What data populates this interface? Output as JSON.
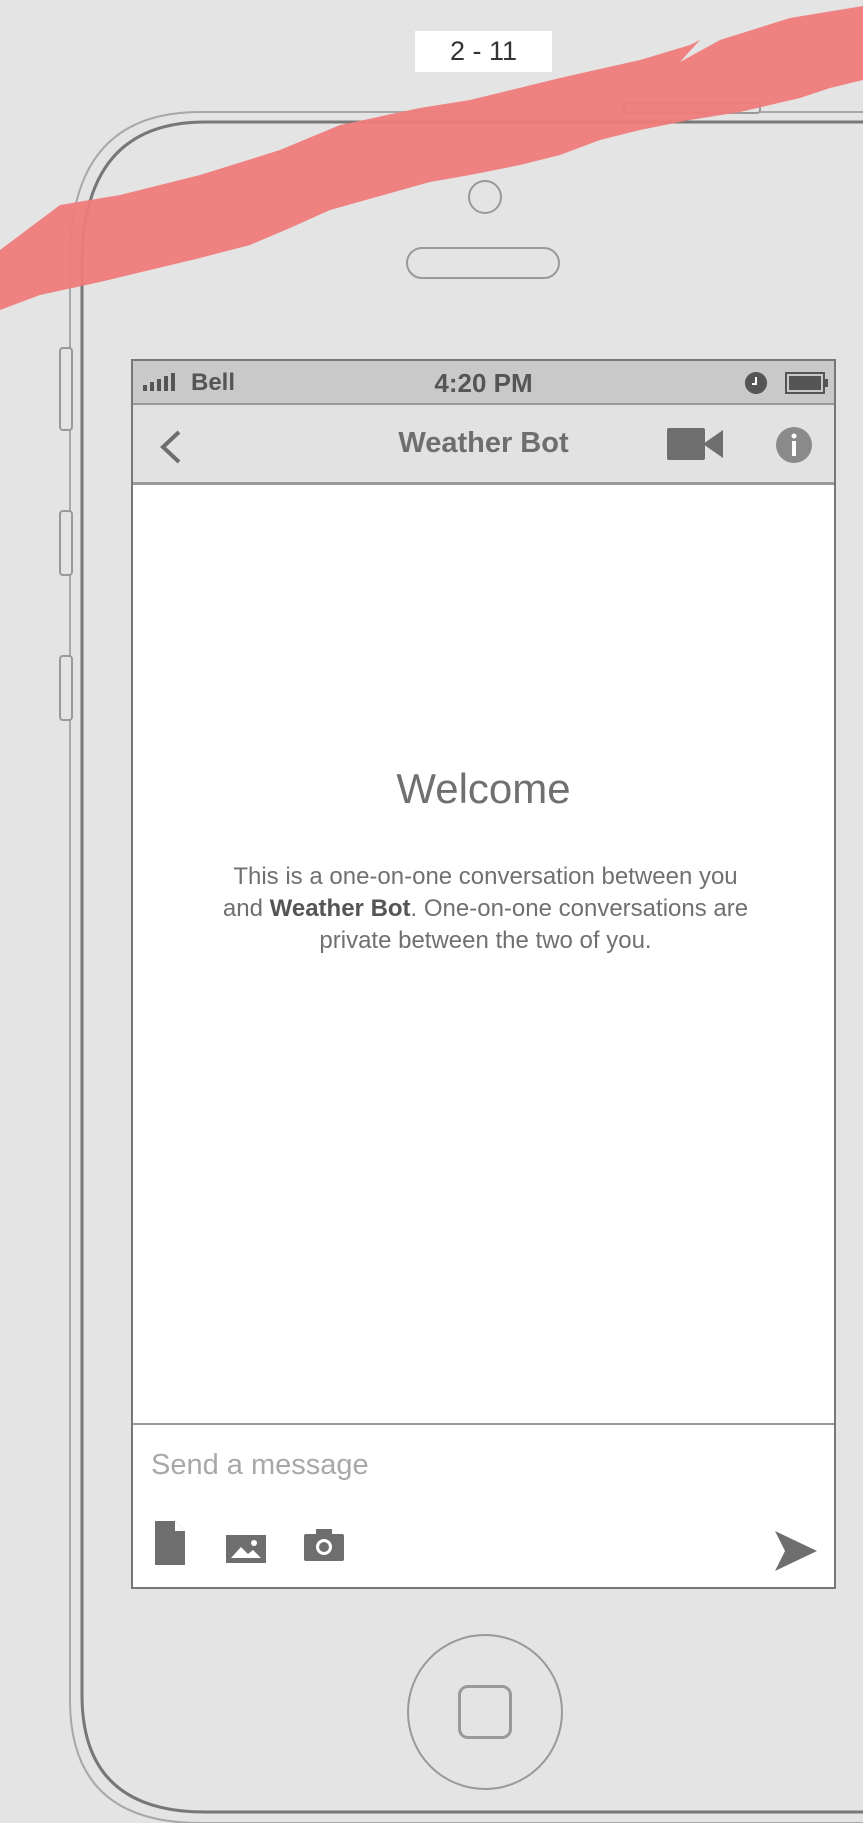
{
  "page_label": "2 - 11",
  "status_bar": {
    "carrier": "Bell",
    "time": "4:20 PM",
    "signal_icon": "signal-bars-icon",
    "alarm_icon": "alarm-clock-icon",
    "battery_icon": "battery-icon"
  },
  "nav_bar": {
    "title": "Weather Bot",
    "back_icon": "chevron-left-icon",
    "video_icon": "video-camera-icon",
    "info_icon": "info-icon"
  },
  "welcome": {
    "title": "Welcome",
    "text_before": "This is a one-on-one conversation between you and ",
    "bot_name": "Weather Bot",
    "text_after": ". One-on-one conversations are private between the two of you."
  },
  "composer": {
    "placeholder": "Send a message",
    "value": "",
    "file_icon": "file-icon",
    "image_icon": "image-icon",
    "camera_icon": "camera-icon",
    "send_icon": "send-icon"
  },
  "colors": {
    "background": "#e4e4e4",
    "accent_brush": "#f07b7b",
    "icon_gray": "#6e6e6e"
  }
}
